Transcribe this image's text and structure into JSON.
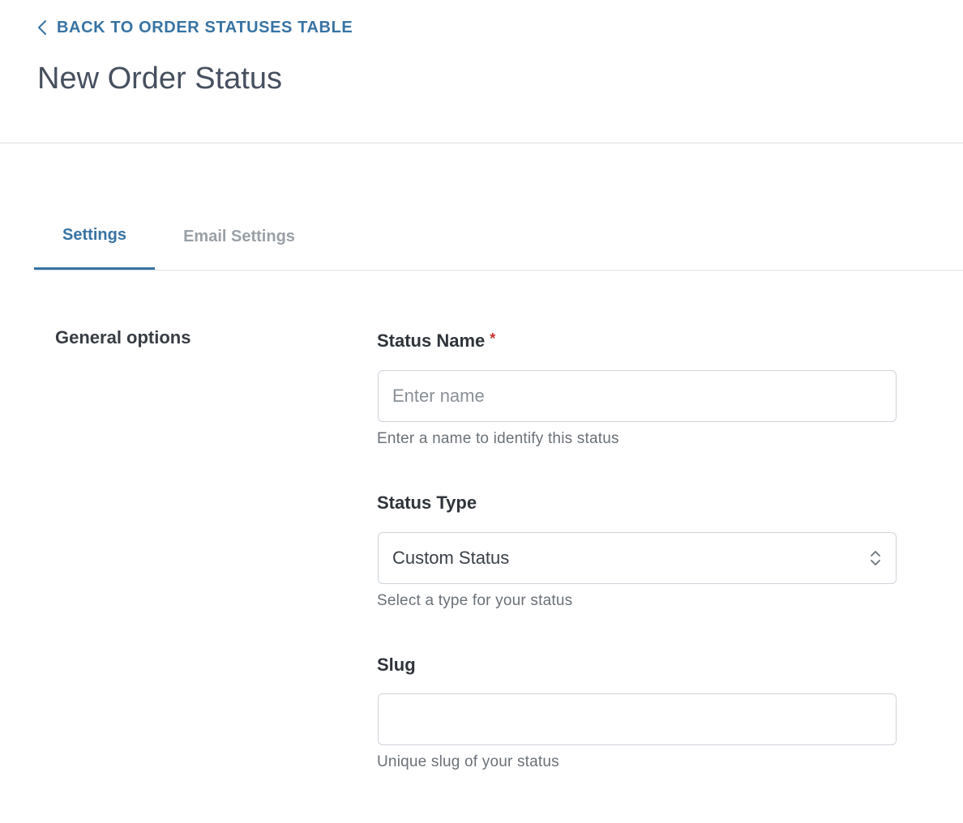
{
  "header": {
    "back_link_label": "BACK TO ORDER STATUSES TABLE",
    "back_icon": "chevron-left-icon",
    "title": "New Order Status"
  },
  "tabs": [
    {
      "label": "Settings",
      "active": true
    },
    {
      "label": "Email Settings",
      "active": false
    }
  ],
  "section": {
    "label": "General options"
  },
  "fields": {
    "status_name": {
      "label": "Status Name",
      "required_marker": "*",
      "placeholder": "Enter name",
      "value": "",
      "help": "Enter a name to identify this status"
    },
    "status_type": {
      "label": "Status Type",
      "selected": "Custom Status",
      "icon": "up-down-chevron-icon",
      "help": "Select a type for your status"
    },
    "slug": {
      "label": "Slug",
      "placeholder": "",
      "value": "",
      "help": "Unique slug of your status"
    }
  },
  "colors": {
    "accent": "#3873a3",
    "required": "#c9302c",
    "title": "#46505f",
    "muted": "#6b7178"
  }
}
